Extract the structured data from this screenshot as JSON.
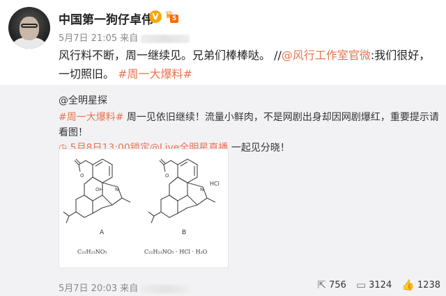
{
  "post": {
    "username": "中国第一狗仔卓伟",
    "level": "5",
    "date": "5月7日 21:05",
    "source_prefix": "来自",
    "text_main": "风行料不断，周一继续见。兄弟们棒棒哒。 //",
    "mention": "@风行工作室官微",
    "text_after": ":我们很好，一切照旧。",
    "hashtag": "#周一大爆料#"
  },
  "repost": {
    "author": "@全明星探",
    "hashtag": "#周一大爆料#",
    "text1": " 周一见依旧继续！流量小鲜肉，不是网剧出身却因网剧爆红，重要提示请看图！",
    "live_link": "5月8日13:00锁定@Live全明星直播",
    "text2": " 一起见分晓！",
    "image": {
      "label_a": "A",
      "label_b": "B",
      "formula_a": "C₂₁H₂₃NO₅",
      "formula_b": "C₂₁H₂₃NO₅ · HCl · H₂O",
      "hcl": "HCl"
    },
    "date": "5月7日 20:03",
    "source_prefix": "来自",
    "reposts": "756",
    "comments": "3124",
    "likes": "1238"
  }
}
